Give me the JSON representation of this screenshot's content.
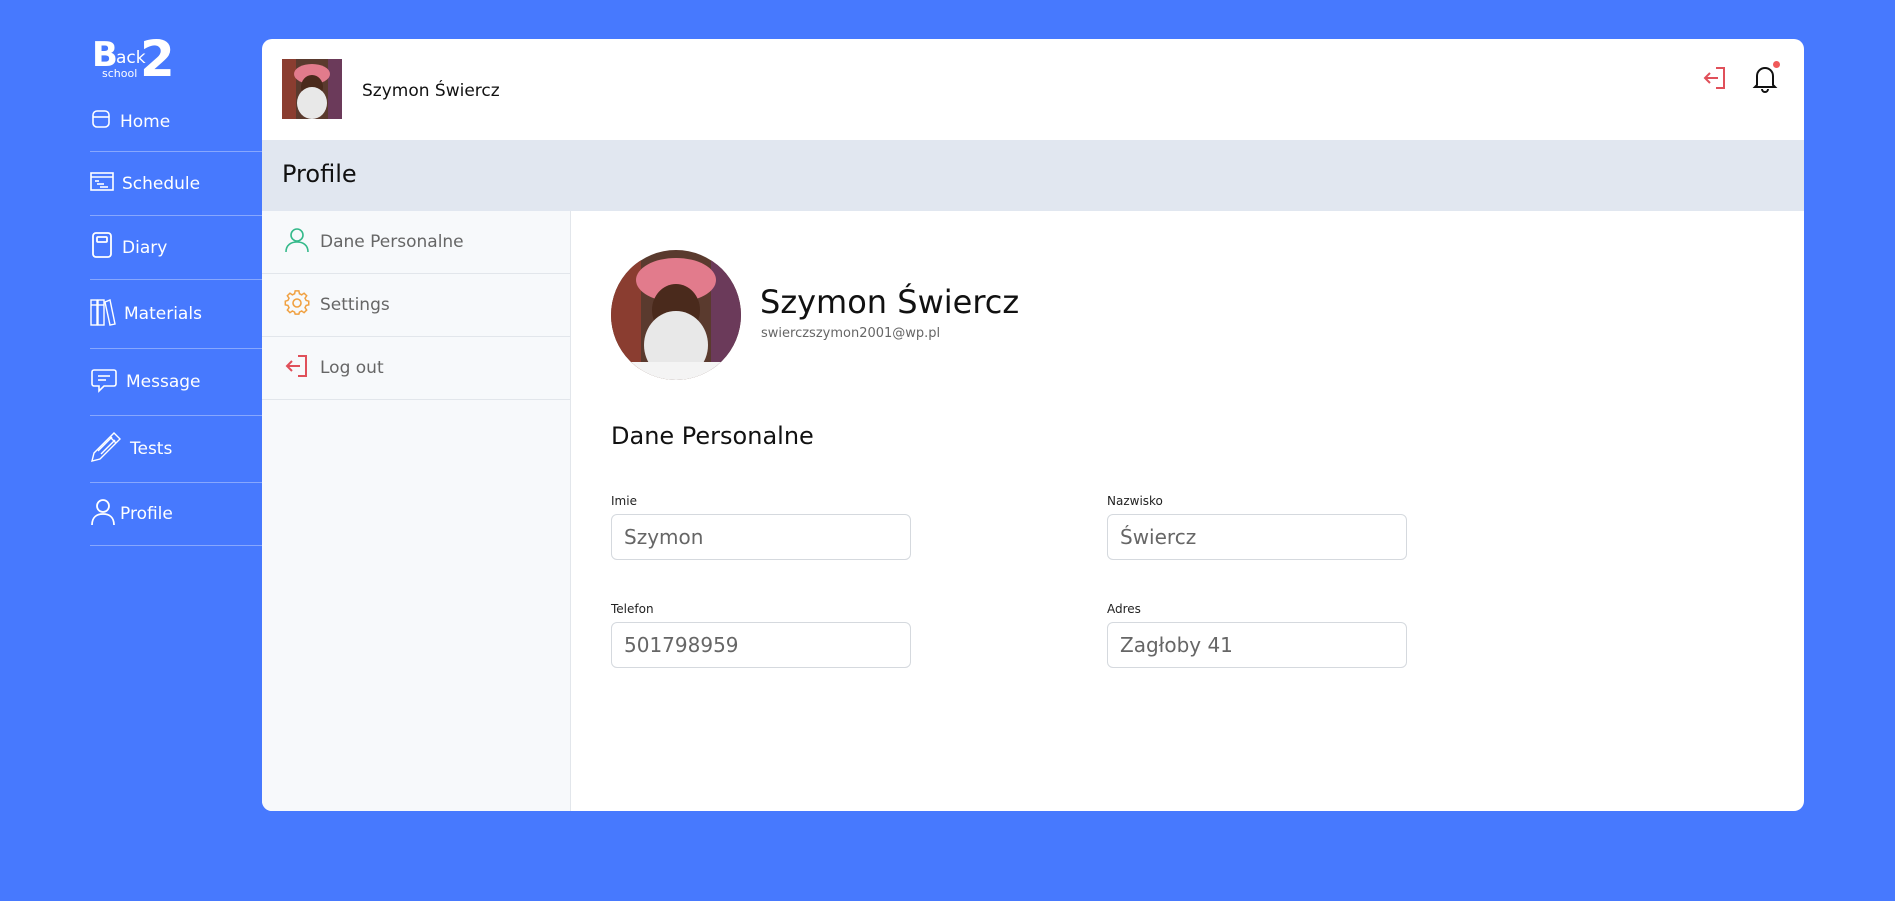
{
  "logo": {
    "b": "B",
    "ack": "ack",
    "school": "school",
    "two": "2"
  },
  "nav": {
    "items": [
      {
        "label": "Home",
        "icon": "home-icon"
      },
      {
        "label": "Schedule",
        "icon": "calendar-icon"
      },
      {
        "label": "Diary",
        "icon": "notebook-icon"
      },
      {
        "label": "Materials",
        "icon": "books-icon"
      },
      {
        "label": "Message",
        "icon": "chat-icon"
      },
      {
        "label": "Tests",
        "icon": "pencil-icon"
      },
      {
        "label": "Profile",
        "icon": "user-icon"
      }
    ]
  },
  "topbar": {
    "username": "Szymon Świercz"
  },
  "page": {
    "title": "Profile"
  },
  "subnav": {
    "items": [
      {
        "label": "Dane Personalne",
        "icon": "user-icon",
        "color": "#34b98a"
      },
      {
        "label": "Settings",
        "icon": "gear-icon",
        "color": "#f0a040"
      },
      {
        "label": "Log out",
        "icon": "logout-icon",
        "color": "#e0505a"
      }
    ]
  },
  "profile": {
    "full_name": "Szymon Świercz",
    "email": "swierczszymon2001@wp.pl",
    "section_title": "Dane Personalne",
    "fields": {
      "imie": {
        "label": "Imie",
        "value": "Szymon"
      },
      "nazwisko": {
        "label": "Nazwisko",
        "value": "Świercz"
      },
      "telefon": {
        "label": "Telefon",
        "value": "501798959"
      },
      "adres": {
        "label": "Adres",
        "value": "Zagłoby 41"
      }
    }
  },
  "colors": {
    "background": "#4779fe",
    "accent_red": "#e0505a",
    "header_band": "#e1e7f0"
  }
}
